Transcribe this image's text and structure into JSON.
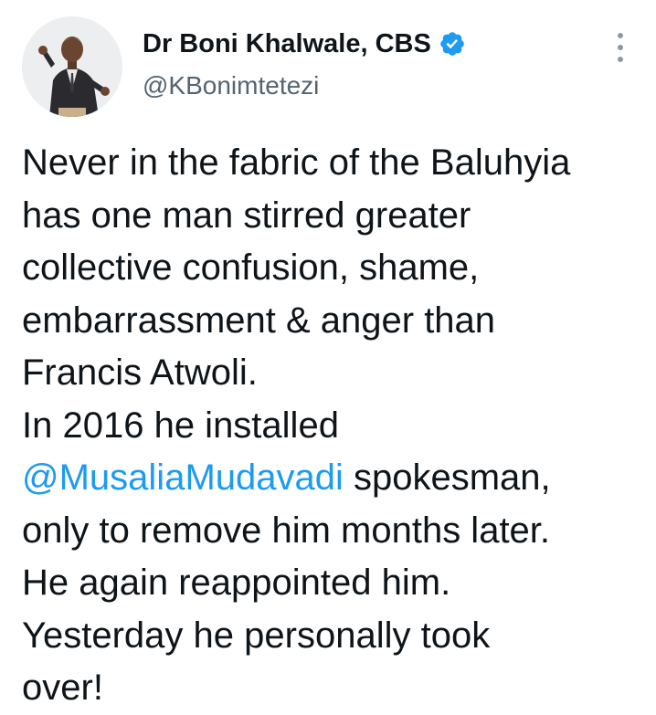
{
  "author": {
    "display_name": "Dr Boni Khalwale, CBS",
    "handle": "@KBonimtetezi",
    "verified": true,
    "verified_icon": "verified-badge-icon",
    "accent_color": "#1d9bf0"
  },
  "more_menu": {
    "icon": "more-options-icon"
  },
  "tweet": {
    "lines": [
      "Never in the fabric of the Baluhyia",
      "has one man stirred greater",
      "collective confusion, shame,",
      "embarrassment & anger than",
      "Francis Atwoli.",
      "In 2016 he installed"
    ],
    "mention": "@MusaliaMudavadi",
    "mention_suffix": " spokesman,",
    "lines_after": [
      "only to remove him months later.",
      "He again reappointed him.",
      "Yesterday he personally took",
      "over!"
    ]
  }
}
